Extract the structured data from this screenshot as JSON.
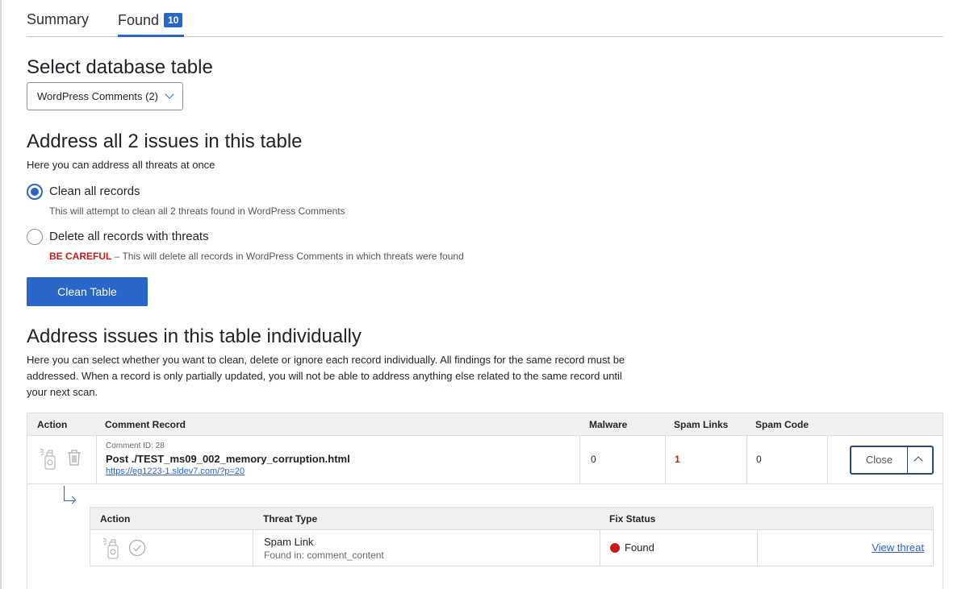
{
  "tabs": {
    "summary": "Summary",
    "found": "Found",
    "found_count": "10"
  },
  "select_section": {
    "heading": "Select database table",
    "selected_value": "WordPress Comments (2)"
  },
  "address_all": {
    "heading": "Address all 2 issues in this table",
    "description": "Here you can address all threats at once",
    "options": [
      {
        "label": "Clean all records",
        "help": "This will attempt to clean all 2 threats found in WordPress Comments",
        "checked": true
      },
      {
        "label": "Delete all records with threats",
        "warning": "BE CAREFUL",
        "help": " – This will delete all records in WordPress Comments in which threats were found",
        "checked": false
      }
    ],
    "button_label": "Clean Table"
  },
  "individual": {
    "heading": "Address issues in this table individually",
    "paragraph": "Here you can select whether you want to clean, delete or ignore each record individually. All findings for the same record must be addressed. When a record is only partially updated, you will not be able to address anything else related to the same record until your next scan.",
    "columns": [
      "Action",
      "Comment Record",
      "Malware",
      "Spam Links",
      "Spam Code"
    ],
    "rows": [
      {
        "comment_id": "Comment ID: 28",
        "title": "Post ./TEST_ms09_002_memory_corruption.html",
        "url": "https://eg1223-1.sldev7.com/?p=20",
        "malware": "0",
        "spam_links": "1",
        "spam_code": "0",
        "toggle_label": "Close"
      }
    ],
    "sub_columns": [
      "Action",
      "Threat Type",
      "Fix Status"
    ],
    "sub_rows": [
      {
        "threat_type": "Spam Link",
        "found_in": "Found in: comment_content",
        "status": "Found",
        "link_label": "View threat"
      }
    ]
  },
  "colors": {
    "accent": "#2a66c7",
    "danger": "#cc1818"
  }
}
